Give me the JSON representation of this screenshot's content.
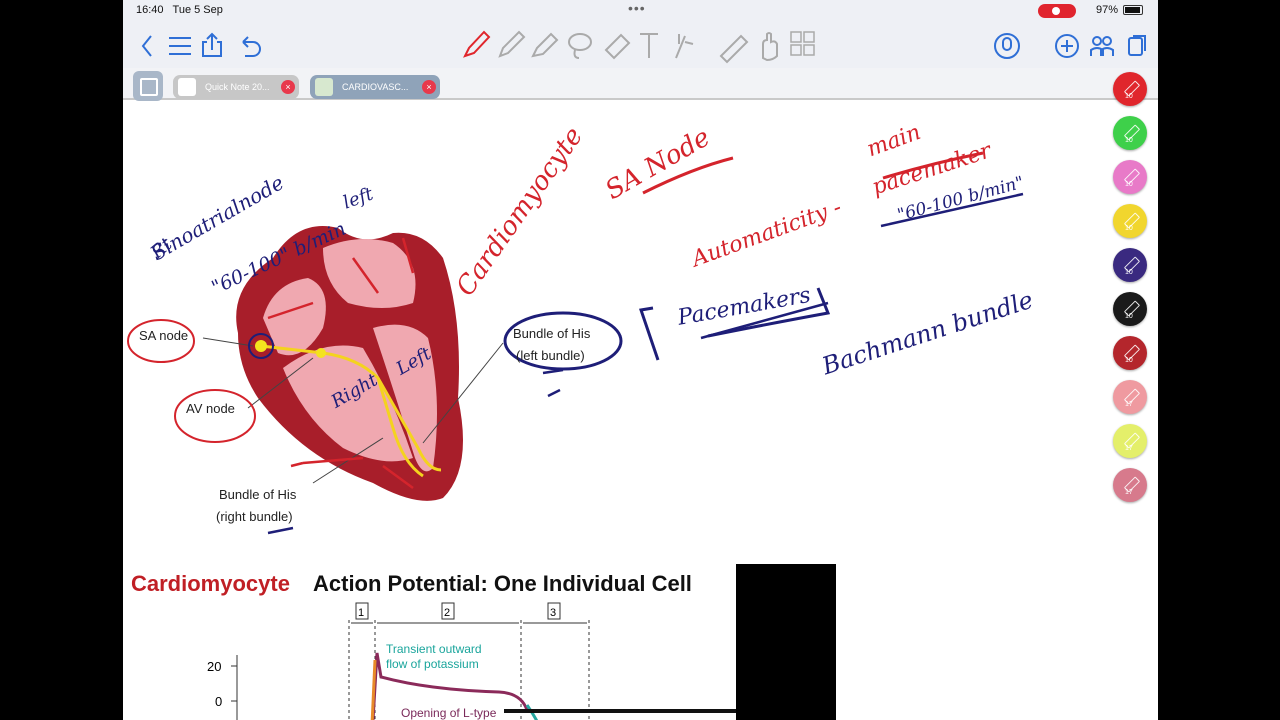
{
  "status": {
    "time": "16:40",
    "date": "Tue 5 Sep",
    "battery": "97%"
  },
  "toolbar": {
    "left_icons": [
      "back-chevron-icon",
      "menu-icon",
      "share-icon",
      "undo-icon"
    ],
    "tools": [
      "pen-icon",
      "pencil-icon",
      "highlighter-icon",
      "lasso-icon",
      "eraser-icon",
      "text-icon",
      "laser-icon",
      "ruler-icon",
      "hand-icon",
      "shapes-icon"
    ],
    "right_icons": [
      "microphone-icon",
      "add-icon",
      "collaborate-icon",
      "pages-icon"
    ]
  },
  "tabs": [
    {
      "label": "Quick Note 20..."
    },
    {
      "label": "CARDIOVASC..."
    }
  ],
  "pens": [
    {
      "color": "#e0262c",
      "size": "10"
    },
    {
      "color": "#3ed04a",
      "size": "10"
    },
    {
      "color": "#e87ac8",
      "size": "10"
    },
    {
      "color": "#f1d62e",
      "size": "10"
    },
    {
      "color": "#3a2a80",
      "size": "10"
    },
    {
      "color": "#1a1a1a",
      "size": "10"
    },
    {
      "color": "#b4262c",
      "size": "10"
    },
    {
      "color": "#ef9aa0",
      "size": "17"
    },
    {
      "color": "#e4ef6a",
      "size": "17"
    },
    {
      "color": "#d77a8c",
      "size": "17"
    }
  ],
  "diagram": {
    "sa_node": "SA node",
    "av_node": "AV node",
    "bundle_left_1": "Bundle of His",
    "bundle_left_2": "(left bundle)",
    "bundle_right_1": "Bundle of His",
    "bundle_right_2": "(right bundle)"
  },
  "handwriting": {
    "rt": "Rt",
    "sinoatrial": "Sinoatrialnode",
    "rate1": "\"60-100\" b/min",
    "left": "left",
    "cardiomyocyte": "Cardiomyocyte",
    "sa_node": "SA Node",
    "automaticity": "Automaticity -",
    "main": "main",
    "pacemaker": "pacemaker",
    "rate2": "\"60-100 b/min\"",
    "pacemakers": "Pacemakers",
    "bachmann": "Bachmann bundle",
    "right": "Right",
    "left2": "Left"
  },
  "ap_slide": {
    "title_red": "Cardiomyocyte",
    "title_black": "Action Potential: One Individual Cell",
    "phases": [
      "1",
      "2",
      "3"
    ],
    "y_ticks": [
      "20",
      "0"
    ],
    "annot1_l1": "Transient outward",
    "annot1_l2": "flow of potassium",
    "annot2": "Opening of L-type"
  }
}
